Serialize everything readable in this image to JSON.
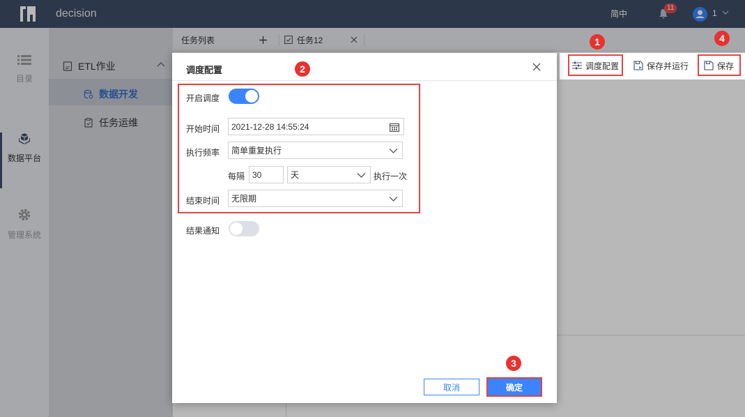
{
  "app": {
    "title": "decision"
  },
  "topbar": {
    "language": "简中",
    "notification_count": "11",
    "user_name": "1"
  },
  "rail": {
    "items": [
      {
        "label": "目录",
        "icon": "list-icon"
      },
      {
        "label": "数据平台",
        "icon": "cubes-icon"
      },
      {
        "label": "管理系统",
        "icon": "gear-icon"
      }
    ]
  },
  "sidebar": {
    "group_label": "ETL作业",
    "items": [
      {
        "label": "数据开发",
        "active": true
      },
      {
        "label": "任务运维",
        "active": false
      }
    ]
  },
  "tabs": [
    {
      "label": "任务列表"
    },
    {
      "label": "任务12"
    }
  ],
  "toolbar": {
    "schedule_config": "调度配置",
    "save_and_run": "保存并运行",
    "save": "保存"
  },
  "steps": [
    "1",
    "2",
    "3",
    "4"
  ],
  "modal": {
    "title": "调度配置",
    "enable_schedule_label": "开启调度",
    "enable_schedule": true,
    "start_time_label": "开始时间",
    "start_time_value": "2021-12-28 14:55:24",
    "frequency_label": "执行频率",
    "frequency_value": "简单重复执行",
    "every_label": "每隔",
    "interval_value": "30",
    "interval_unit": "天",
    "execute_once_label": "执行一次",
    "end_time_label": "结束时间",
    "end_time_value": "无限期",
    "notify_label": "结果通知",
    "notify": false,
    "cancel_label": "取消",
    "ok_label": "确定"
  },
  "colors": {
    "accent": "#3a85ff",
    "topbar": "#3d4d66",
    "highlight": "#e04444",
    "badge": "#e8322f"
  }
}
